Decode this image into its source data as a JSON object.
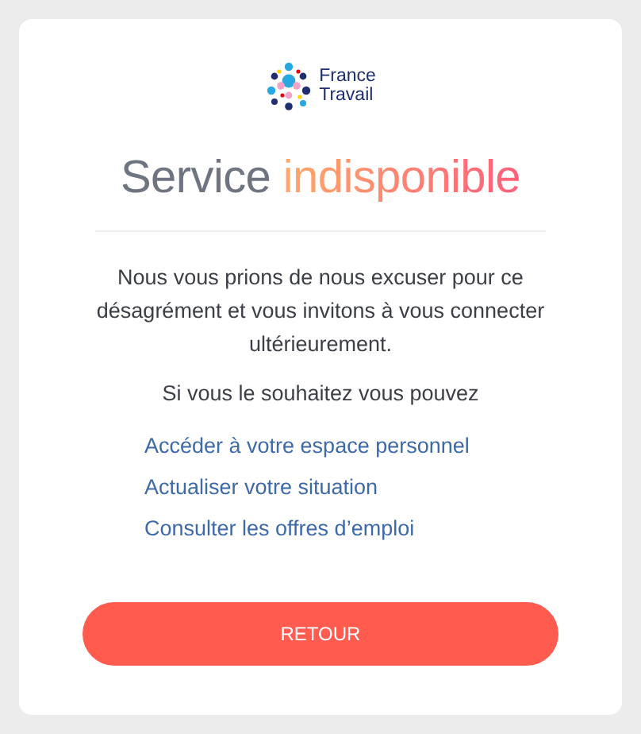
{
  "logo": {
    "lines": [
      "France",
      "Travail"
    ]
  },
  "title": {
    "lead": "Service",
    "accent": "indisponible"
  },
  "message": "Nous vous prions de nous excuser pour ce désagrément et vous invitons à vous connecter ultérieurement.",
  "prompt": "Si vous le souhaitez vous pouvez",
  "links": [
    "Accéder à votre espace personnel",
    "Actualiser votre situation",
    "Consulter les offres d’emploi"
  ],
  "button": "RETOUR"
}
